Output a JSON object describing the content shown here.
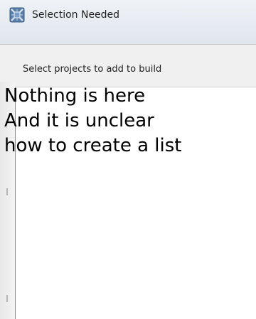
{
  "dialog": {
    "title": "Selection Needed",
    "message": "Select projects to add to build",
    "icon": "app-window-icon"
  },
  "annotation": {
    "lines": [
      "Nothing is here",
      "And it is unclear",
      "how to create a list"
    ],
    "color": "#000000"
  },
  "colors": {
    "titlebar": "#e6ebf1",
    "body": "#f0f0f0",
    "list_background": "#ffffff"
  }
}
